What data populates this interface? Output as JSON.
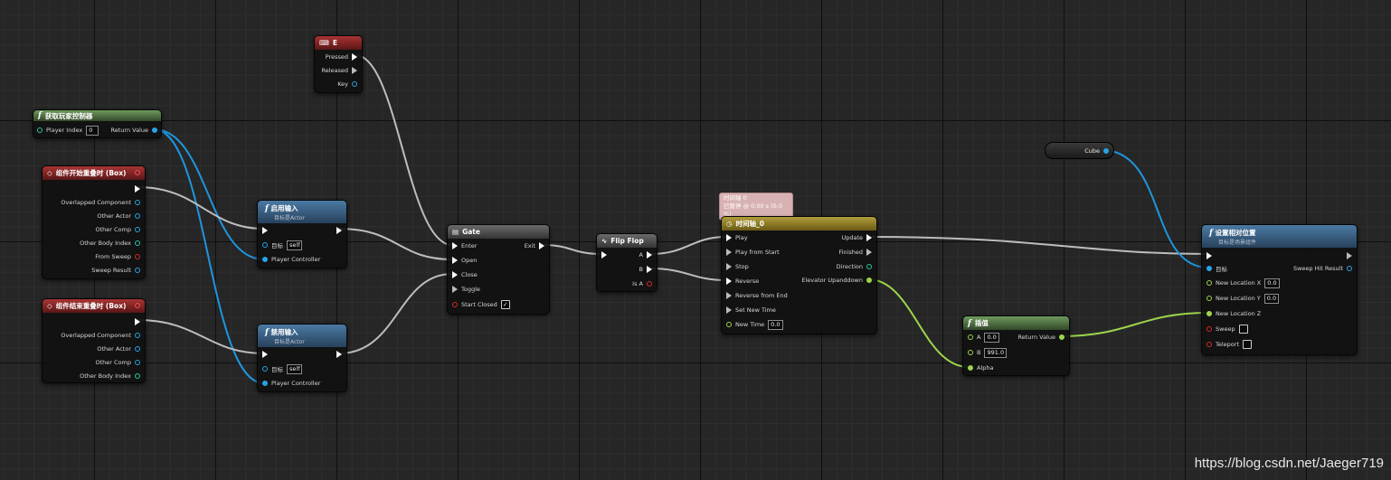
{
  "nodes": {
    "key_e": {
      "title": "E",
      "pins": {
        "pressed": "Pressed",
        "released": "Released",
        "key": "Key"
      }
    },
    "get_player_controller": {
      "title": "获取玩家控制器",
      "pins": {
        "player_index": "Player Index",
        "player_index_value": "0",
        "return_value": "Return Value"
      }
    },
    "begin_overlap": {
      "title": "组件开始重叠时 (Box)",
      "pins": {
        "overlapped_component": "Overlapped Component",
        "other_actor": "Other Actor",
        "other_comp": "Other Comp",
        "other_body_index": "Other Body Index",
        "from_sweep": "From Sweep",
        "sweep_result": "Sweep Result"
      }
    },
    "end_overlap": {
      "title": "组件结束重叠时 (Box)",
      "pins": {
        "overlapped_component": "Overlapped Component",
        "other_actor": "Other Actor",
        "other_comp": "Other Comp",
        "other_body_index": "Other Body Index"
      }
    },
    "enable_input": {
      "title": "启用输入",
      "subtitle": "目标是Actor",
      "pins": {
        "target": "目标",
        "target_value": "self",
        "player_controller": "Player Controller"
      }
    },
    "disable_input": {
      "title": "禁用输入",
      "subtitle": "目标是Actor",
      "pins": {
        "target": "目标",
        "target_value": "self",
        "player_controller": "Player Controller"
      }
    },
    "gate": {
      "title": "Gate",
      "pins": {
        "enter": "Enter",
        "exit": "Exit",
        "open": "Open",
        "close": "Close",
        "toggle": "Toggle",
        "start_closed": "Start Closed"
      }
    },
    "flip_flop": {
      "title": "Flip Flop",
      "pins": {
        "a": "A",
        "b": "B",
        "is_a": "Is A"
      }
    },
    "timeline": {
      "comment_line1": "时间轴 0",
      "comment_line2": "已暂停 @ 0.00 s (0.0 %)",
      "title": "时间轴_0",
      "pins": {
        "play": "Play",
        "play_from_start": "Play from Start",
        "stop": "Stop",
        "reverse": "Reverse",
        "reverse_from_end": "Reverse from End",
        "set_new_time": "Set New Time",
        "new_time": "New Time",
        "new_time_value": "0.0",
        "update": "Update",
        "finished": "Finished",
        "direction": "Direction",
        "elevator_updown": "Elevator Upanddown"
      }
    },
    "lerp": {
      "title": "插值",
      "pins": {
        "a": "A",
        "a_value": "0.0",
        "b": "B",
        "b_value": "991.0",
        "alpha": "Alpha",
        "return_value": "Return Value"
      }
    },
    "cube": {
      "title": "Cube"
    },
    "set_relative_location": {
      "title": "设置相对位置",
      "subtitle": "目标是场景组件",
      "pins": {
        "target": "目标",
        "sweep_hit_result": "Sweep Hit Result",
        "new_location_x": "New Location X",
        "new_location_x_value": "0.0",
        "new_location_y": "New Location Y",
        "new_location_y_value": "0.0",
        "new_location_z": "New Location Z",
        "sweep": "Sweep",
        "teleport": "Teleport"
      }
    }
  },
  "watermark": "https://blog.csdn.net/Jaeger719",
  "colors": {
    "exec": "#ffffff",
    "object": "#29a3e6",
    "float": "#9dd54b",
    "int": "#2ec5a6",
    "bool": "#d32a2a",
    "wire_exec": "#d0d0d0"
  }
}
